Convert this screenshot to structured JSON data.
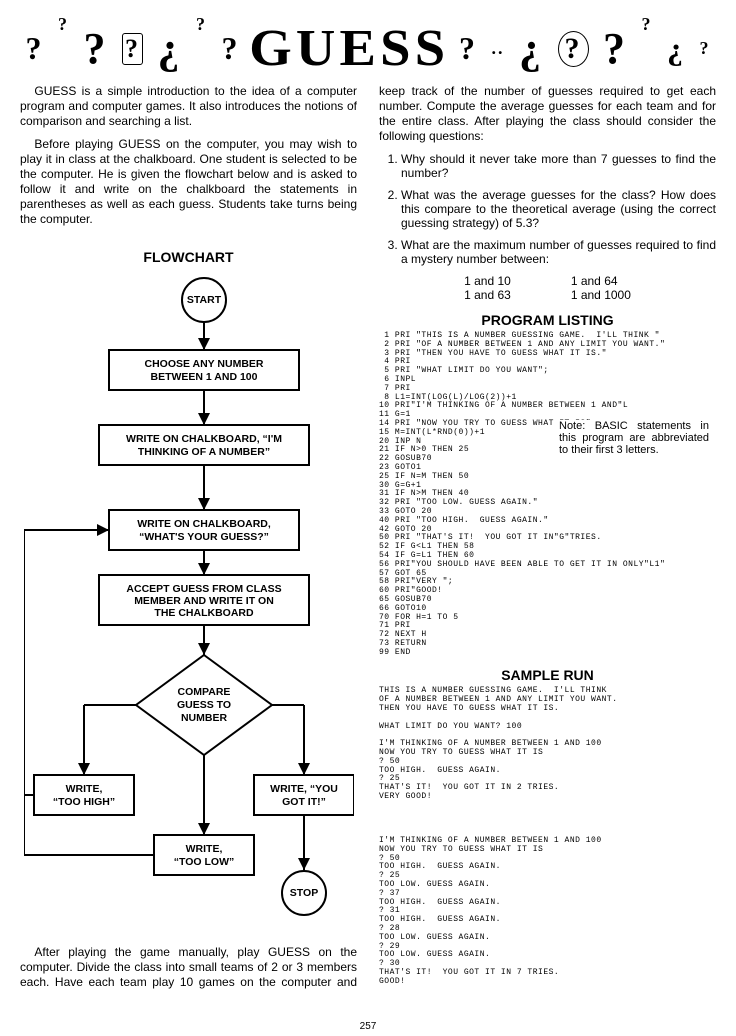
{
  "banner": {
    "deco_left": "?  ?  ¿  ?",
    "title": "GUESS",
    "deco_right": "?  ¿  ?"
  },
  "paras": {
    "p1": "GUESS is a simple introduction to the idea of a computer program and computer games. It also introduces the notions of comparison and searching a list.",
    "p2": "Before playing GUESS on the computer, you may wish to play it in class at the chalkboard. One student is selected to be the computer. He is given the flowchart below and is asked to follow it and write on the chalkboard the statements in parentheses as well as each guess. Students take turns being the computer.",
    "p3": "After playing the game manually, play GUESS on the computer. Divide the class into small teams of 2 or 3 members each. Have each team play 10 games on the computer and keep track of the number of guesses required to get each number. Compute the average guesses for each team and for the entire class. After playing the class should consider the following questions:"
  },
  "flowchart": {
    "heading": "FLOWCHART",
    "start": "START",
    "b1a": "CHOOSE ANY NUMBER",
    "b1b": "BETWEEN 1 AND 100",
    "b2a": "WRITE ON CHALKBOARD, “I'M",
    "b2b": "THINKING OF A NUMBER”",
    "b3a": "WRITE ON CHALKBOARD,",
    "b3b": "“WHAT'S YOUR GUESS?”",
    "b4a": "ACCEPT GUESS FROM CLASS",
    "b4b": "MEMBER AND WRITE IT ON",
    "b4c": "THE CHALKBOARD",
    "d1a": "COMPARE",
    "d1b": "GUESS TO",
    "d1c": "NUMBER",
    "r_left_a": "WRITE,",
    "r_left_b": "“TOO HIGH”",
    "r_mid_a": "WRITE,",
    "r_mid_b": "“TOO LOW”",
    "r_right_a": "WRITE, “YOU",
    "r_right_b": "GOT IT!”",
    "stop": "STOP"
  },
  "questions": {
    "q1": "Why should it never take more than 7 guesses to find the number?",
    "q2": "What was the average guesses for the class? How does this compare to the theoretical average (using the correct guessing strategy) of 5.3?",
    "q3": "What are the maximum number of guesses required to find a mystery number between:"
  },
  "ranges": {
    "r1": "1 and 10",
    "r2": "1 and 63",
    "r3": "1 and 64",
    "r4": "1 and 1000"
  },
  "headings": {
    "program_listing": "PROGRAM LISTING",
    "sample_run": "SAMPLE RUN"
  },
  "note": "Note: BASIC statements in this program are abbreviated to their first 3 letters.",
  "listing": " 1 PRI \"THIS IS A NUMBER GUESSING GAME.  I'LL THINK \"\n 2 PRI \"OF A NUMBER BETWEEN 1 AND ANY LIMIT YOU WANT.\"\n 3 PRI \"THEN YOU HAVE TO GUESS WHAT IT IS.\"\n 4 PRI\n 5 PRI \"WHAT LIMIT DO YOU WANT\";\n 6 INPL\n 7 PRI\n 8 L1=INT(LOG(L)/LOG(2))+1\n10 PRI\"I'M THINKING OF A NUMBER BETWEEN 1 AND\"L\n11 G=1\n14 PRI \"NOW YOU TRY TO GUESS WHAT IT IS\"\n15 M=INT(L*RND(0))+1\n20 INP N\n21 IF N>0 THEN 25\n22 GOSUB70\n23 GOTO1\n25 IF N=M THEN 50\n30 G=G+1\n31 IF N>M THEN 40\n32 PRI \"TOO LOW. GUESS AGAIN.\"\n33 GOTO 20\n40 PRI \"TOO HIGH.  GUESS AGAIN.\"\n42 GOTO 20\n50 PRI \"THAT'S IT!  YOU GOT IT IN\"G\"TRIES.\n52 IF G<L1 THEN 58\n54 IF G=L1 THEN 60\n56 PRI\"YOU SHOULD HAVE BEEN ABLE TO GET IT IN ONLY\"L1\"\n57 GOT 65\n58 PRI\"VERY \";\n60 PRI\"GOOD!\n65 GOSUB70\n66 GOTO10\n70 FOR H=1 TO 5\n71 PRI\n72 NEXT H\n73 RETURN\n99 END",
  "run": "THIS IS A NUMBER GUESSING GAME.  I'LL THINK\nOF A NUMBER BETWEEN 1 AND ANY LIMIT YOU WANT.\nTHEN YOU HAVE TO GUESS WHAT IT IS.\n\nWHAT LIMIT DO YOU WANT? 100\n\nI'M THINKING OF A NUMBER BETWEEN 1 AND 100\nNOW YOU TRY TO GUESS WHAT IT IS\n? 50\nTOO HIGH.  GUESS AGAIN.\n? 25\nTHAT'S IT!  YOU GOT IT IN 2 TRIES.\nVERY GOOD!\n\n\n\n\nI'M THINKING OF A NUMBER BETWEEN 1 AND 100\nNOW YOU TRY TO GUESS WHAT IT IS\n? 50\nTOO HIGH.  GUESS AGAIN.\n? 25\nTOO LOW. GUESS AGAIN.\n? 37\nTOO HIGH.  GUESS AGAIN.\n? 31\nTOO HIGH.  GUESS AGAIN.\n? 28\nTOO LOW. GUESS AGAIN.\n? 29\nTOO LOW. GUESS AGAIN.\n? 30\nTHAT'S IT!  YOU GOT IT IN 7 TRIES.\nGOOD!",
  "page_number": "257"
}
